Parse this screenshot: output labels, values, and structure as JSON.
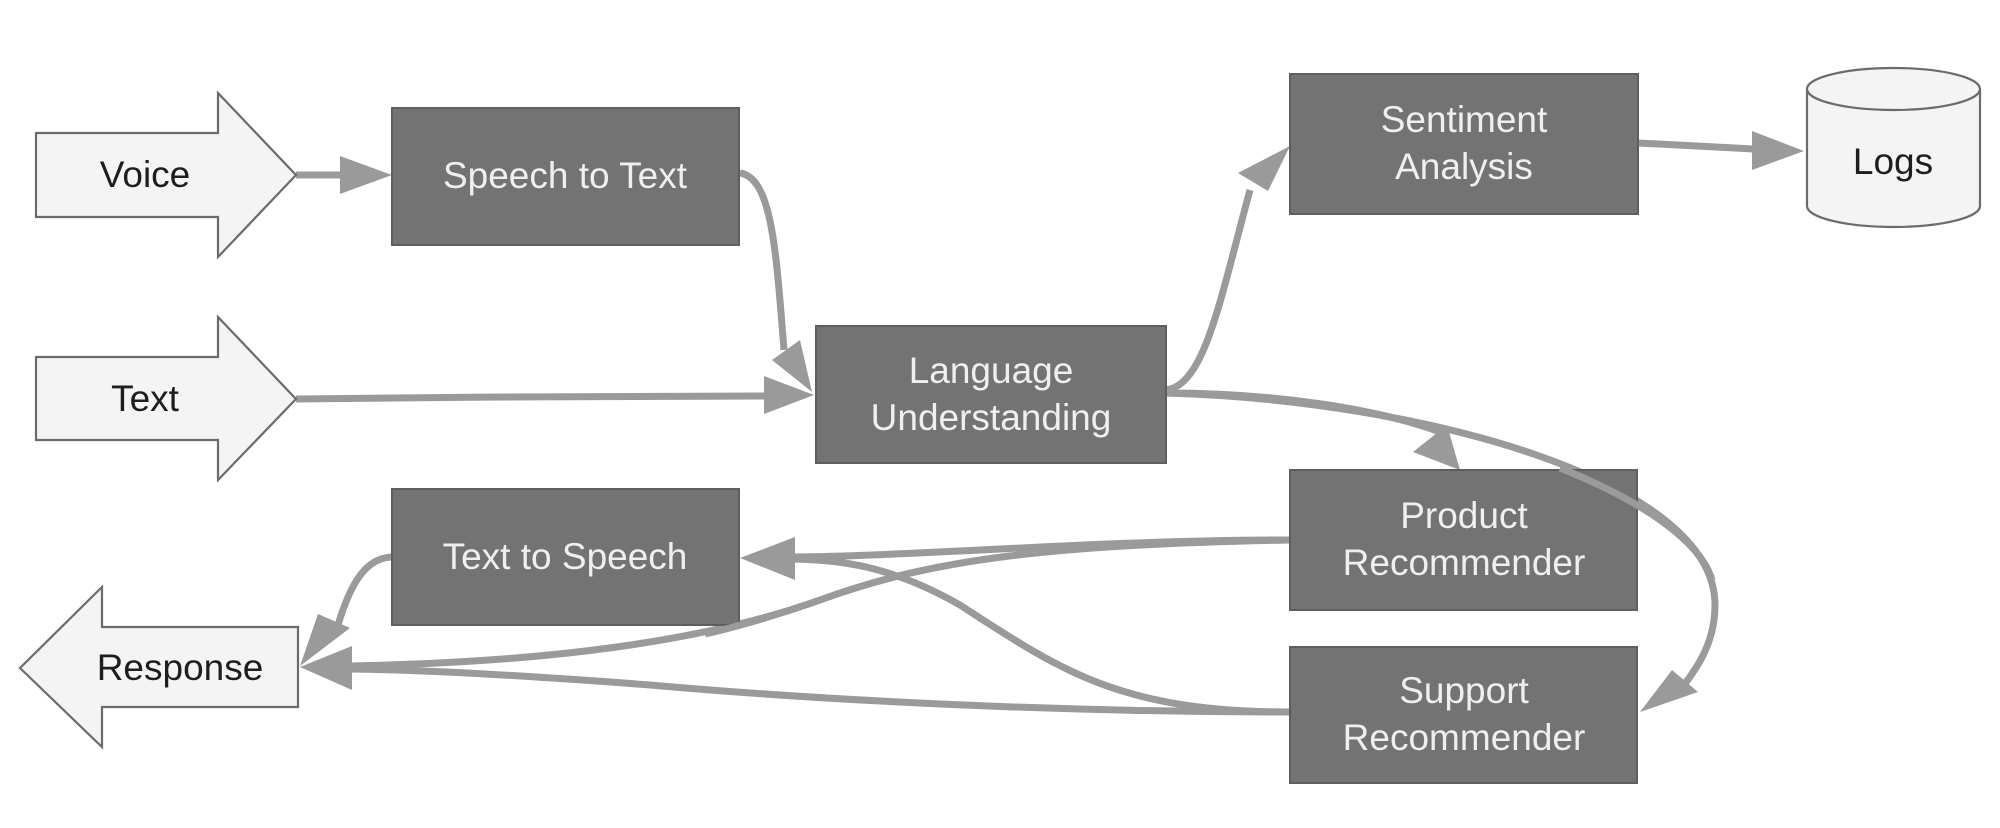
{
  "diagram": {
    "colors": {
      "process_fill": "#737373",
      "process_text": "#efefef",
      "io_fill": "#f4f4f4",
      "io_text": "#1e1e1e",
      "connector": "#9a9a9a"
    },
    "nodes": {
      "voice": {
        "label": "Voice",
        "shape": "right-arrow"
      },
      "text": {
        "label": "Text",
        "shape": "right-arrow"
      },
      "response": {
        "label": "Response",
        "shape": "left-arrow"
      },
      "speech_to_text": {
        "lines": [
          "Speech to Text"
        ],
        "shape": "rectangle"
      },
      "language_understanding": {
        "lines": [
          "Language",
          "Understanding"
        ],
        "shape": "rectangle"
      },
      "sentiment_analysis": {
        "lines": [
          "Sentiment",
          "Analysis"
        ],
        "shape": "rectangle"
      },
      "logs": {
        "label": "Logs",
        "shape": "cylinder"
      },
      "product_recommender": {
        "lines": [
          "Product",
          "Recommender"
        ],
        "shape": "rectangle"
      },
      "support_recommender": {
        "lines": [
          "Support",
          "Recommender"
        ],
        "shape": "rectangle"
      },
      "text_to_speech": {
        "lines": [
          "Text to Speech"
        ],
        "shape": "rectangle"
      }
    },
    "edges": [
      {
        "from": "Voice",
        "to": "Speech to Text"
      },
      {
        "from": "Speech to Text",
        "to": "Language Understanding"
      },
      {
        "from": "Text",
        "to": "Language Understanding"
      },
      {
        "from": "Language Understanding",
        "to": "Sentiment Analysis"
      },
      {
        "from": "Sentiment Analysis",
        "to": "Logs"
      },
      {
        "from": "Language Understanding",
        "to": "Product Recommender"
      },
      {
        "from": "Language Understanding",
        "to": "Support Recommender"
      },
      {
        "from": "Product Recommender",
        "to": "Text to Speech"
      },
      {
        "from": "Product Recommender",
        "to": "Response"
      },
      {
        "from": "Support Recommender",
        "to": "Text to Speech"
      },
      {
        "from": "Support Recommender",
        "to": "Response"
      },
      {
        "from": "Text to Speech",
        "to": "Response"
      }
    ]
  }
}
